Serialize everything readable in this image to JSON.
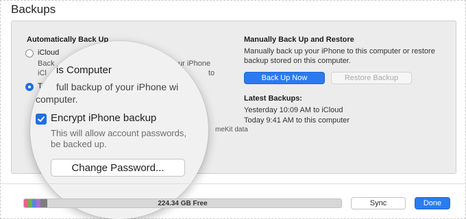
{
  "section": {
    "title": "Backups"
  },
  "auto": {
    "heading": "Automatically Back Up",
    "icloud_label": "iCloud",
    "icloud_desc_1": "Back",
    "icloud_desc_1_tail": "ur iPhone",
    "icloud_desc_2": "iCl",
    "icloud_desc_2_tail": "to",
    "this_computer_label": "T",
    "encrypt_note_tail": "meKit data"
  },
  "manual": {
    "heading": "Manually Back Up and Restore",
    "desc": "Manually back up your iPhone to this computer or restore backup stored on this computer.",
    "back_up_now": "Back Up Now",
    "restore_backup": "Restore Backup"
  },
  "latest": {
    "heading": "Latest Backups:",
    "entries": [
      "Yesterday 10:09 AM to iCloud",
      "Today 9:41 AM to this computer"
    ]
  },
  "magnifier": {
    "this_computer": "is Computer",
    "desc_line1": "full backup of your iPhone wi",
    "desc_line2": "computer.",
    "encrypt_label": "Encrypt iPhone backup",
    "encrypt_desc_1": "This will allow account passwords,",
    "encrypt_desc_2": "be backed up.",
    "change_password": "Change Password..."
  },
  "storage": {
    "free_label": "224.34 GB Free",
    "segments": [
      {
        "color": "#e9608f"
      },
      {
        "color": "#6fb24b"
      },
      {
        "color": "#4a8ee0"
      },
      {
        "color": "#b16ad4"
      },
      {
        "color": "#7d7d7d"
      }
    ]
  },
  "footer": {
    "sync": "Sync",
    "done": "Done"
  },
  "colors": {
    "accent": "#2b7bf0"
  }
}
